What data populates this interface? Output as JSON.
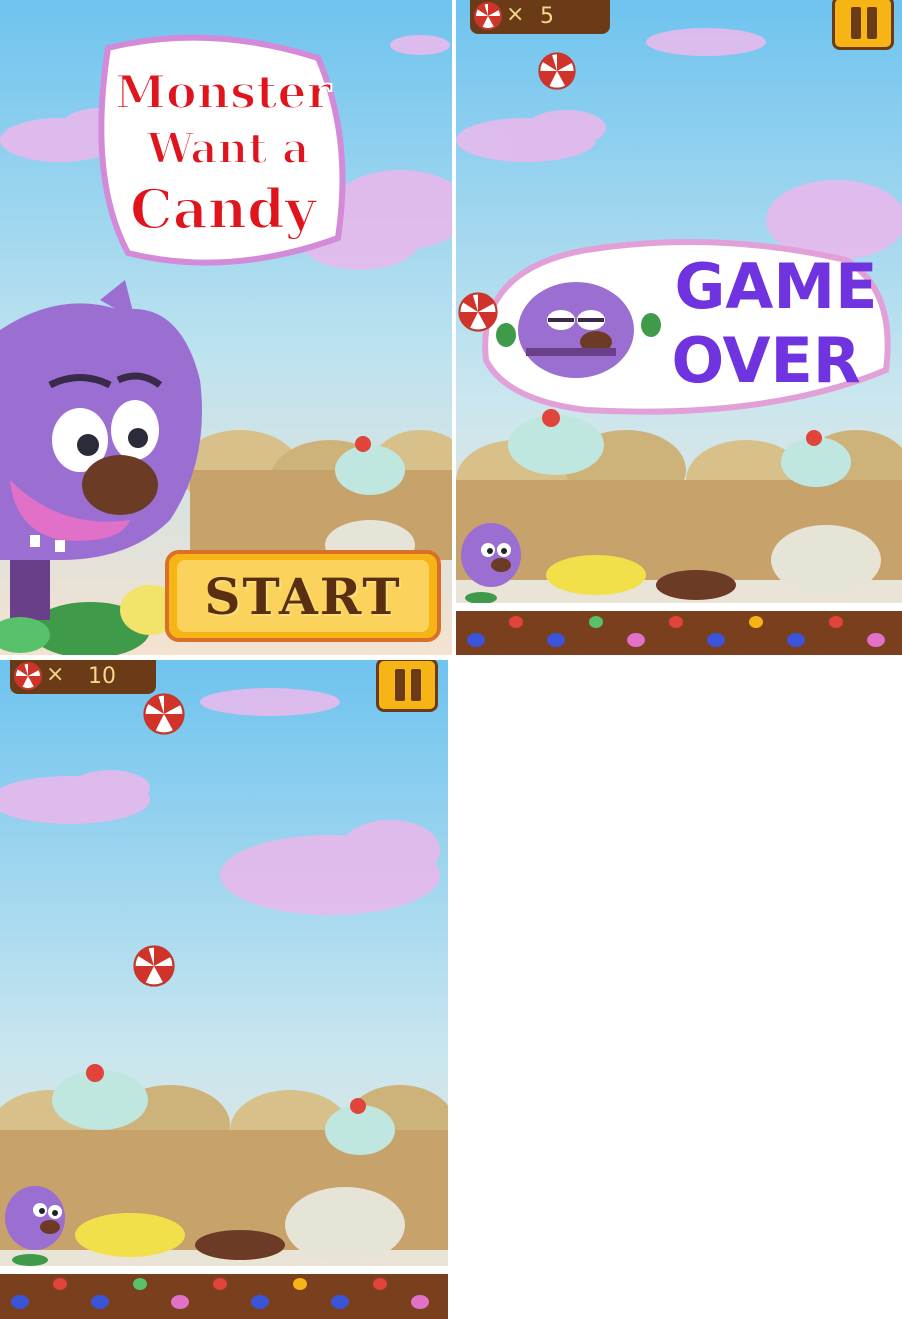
{
  "game": {
    "title_lines": [
      "Monster",
      "Want a",
      "Candy"
    ],
    "start_label": "START",
    "game_over_lines": [
      "GAME",
      "OVER"
    ]
  },
  "screens": [
    {
      "name": "title-screen"
    },
    {
      "name": "game-over-screen",
      "candy_count": "5",
      "multiplier_symbol": "×"
    },
    {
      "name": "gameplay-screen",
      "candy_count": "10",
      "multiplier_symbol": "×"
    }
  ],
  "colors": {
    "sky_top": "#6ec3ef",
    "sky_bottom": "#f3e3cf",
    "title_red": "#e0141c",
    "game_over_purple": "#7033e0",
    "monster_purple": "#9b6fd1",
    "button_yellow": "#f6b514",
    "wood_brown": "#6b3b17"
  },
  "icons": [
    "candy-icon",
    "pause-icon",
    "monster-icon",
    "cupcake-icon",
    "muffin-icon"
  ]
}
